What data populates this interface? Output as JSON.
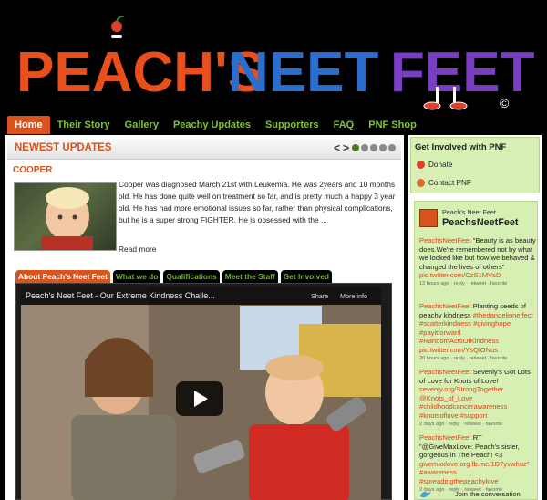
{
  "header": {
    "title_words": [
      "PEACH'S",
      "NEET",
      "FEET"
    ],
    "copyright_mark": "©"
  },
  "nav": {
    "items": [
      "Home",
      "Their Story",
      "Gallery",
      "Peachy Updates",
      "Supporters",
      "FAQ",
      "PNF Shop"
    ],
    "active": "Home"
  },
  "updates": {
    "title": "NEWEST UPDATES",
    "prev": "<",
    "next": ">",
    "dots_total": 5,
    "active_dot": 1,
    "post": {
      "name": "COOPER",
      "text": "Cooper was diagnosed March 21st with Leukemia. He was 2years and 10 months old. He has done quite well on treatment so far, and is pretty much a happy 3 year old. He has had more emotional issues so far, rather than physical complications, but he is a super strong FIGHTER. He is obsessed with the ...",
      "read_more": "Read more"
    }
  },
  "tabs": {
    "items": [
      "About Peach's Neet Feet",
      "What we do",
      "Qualifications",
      "Meet the Staff",
      "Get Involved"
    ],
    "active": "About Peach's Neet Feet"
  },
  "video": {
    "title": "Peach's Neet Feet - Our Extreme Kindness Challe...",
    "share": "Share",
    "info": "More info"
  },
  "sidebar": {
    "involved_title": "Get Involved with PNF",
    "donate": "Donate",
    "contact": "Contact PNF",
    "twitter": {
      "name": "Peach's Neet Feet",
      "handle": "PeachsNeetFeet",
      "tweets": [
        {
          "user": "PeachsNeetFeet",
          "text": " \"Beauty is as beauty does.We're remembered not by what we looked like but how we behaved & changed the lives of others\" ",
          "link": "pic.twitter.com/CzS1MVsD",
          "meta": "12 hours ago · reply · retweet · favorite"
        },
        {
          "user": "PeachsNeetFeet",
          "text": " Planting seeds of peachy kindness ",
          "link": "#thedandelioneffect #scatterkindness #givinghope #payitforward #RandomActsOfKindness pic.twitter.com/YsQlONus",
          "meta": "20 hours ago · reply · retweet · favorite"
        },
        {
          "user": "PeachsNeetFeet",
          "text": " Sevenly's Got Lots of Love for Knots of Love! ",
          "link": "sevenly.org/StrongTogether @Knots_of_Love #childhoodcancerawareness #knotsoflove #support",
          "meta": "2 days ago · reply · retweet · favorite"
        },
        {
          "user": "PeachsNeetFeet",
          "text": " RT \"@GiveMaxLove: Peach's sister, gorgeous in The Peach! <3 ",
          "link": "givemaxlove.org fb.me/1D7yvwhuz\" #awareness #spreadingthepeachylove",
          "meta": "2 days ago · reply · retweet · favorite"
        }
      ],
      "join": "Join the conversation"
    }
  },
  "colors": {
    "accent_orange": "#d9541c",
    "nav_green": "#7ec432",
    "panel_green": "#d8efb5"
  }
}
